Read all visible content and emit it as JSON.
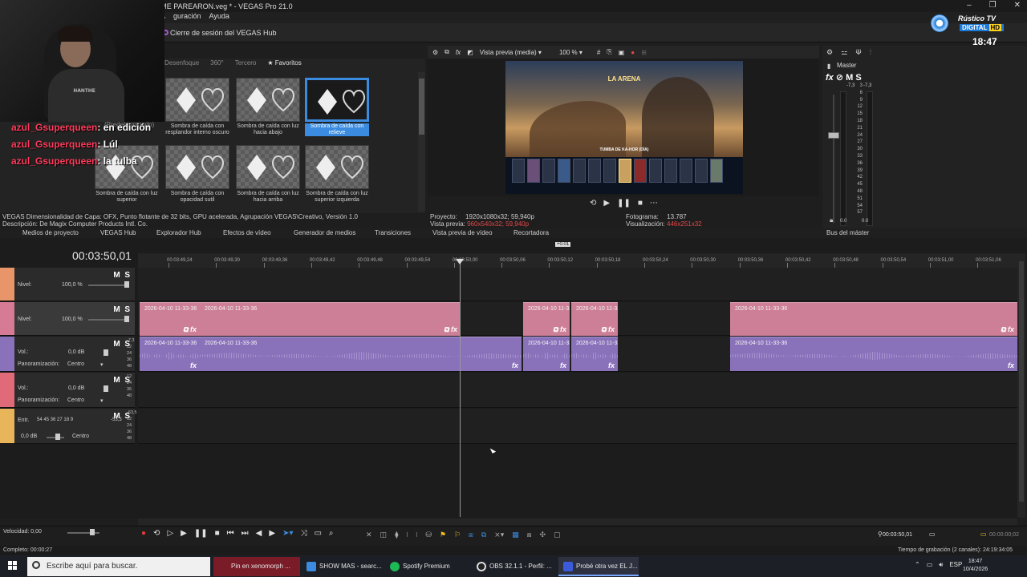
{
  "window": {
    "title": "Probé otra vez EL JUEGO DE INVINCIBLE y ME PAREARON.veg * - VEGAS Pro 21.0",
    "minimize": "–",
    "maximize": "❐",
    "close": "✕"
  },
  "menu": {
    "items": [
      "A",
      "guración",
      "Ayuda"
    ]
  },
  "hub": {
    "label": "Cierre de sesión del VEGAS Hub"
  },
  "tv": {
    "brand": "Rústico TV",
    "sub": "DIGITAL",
    "hd": "HD",
    "clock": "18:47"
  },
  "chat": {
    "watermark": "(Predeterminado)",
    "lines": [
      {
        "user": "azul_Gsuperqueen",
        "msg": ": en edición"
      },
      {
        "user": "azul_Gsuperqueen",
        "msg": ": Lúl"
      },
      {
        "user": "azul_Gsuperqueen",
        "msg": ": la tulba"
      }
    ]
  },
  "fx_browser": {
    "tabs": [
      "Desenfoque",
      "360°",
      "Tercero",
      "Favoritos"
    ],
    "presets": [
      "Sombra de caída con resplandor interno oscuro",
      "Sombra de caída con luz hacia abajo",
      "Sombra de caída con relieve",
      "Sombra de caída con luz superior",
      "Sombra de caída con opacidad sutil",
      "Sombra de caída con luz hacia arriba",
      "Sombra de caída con luz superior izquierda"
    ],
    "info_line1": "VEGAS Dimensionalidad de Capa: OFX, Punto flotante de 32 bits, GPU acelerada, Agrupación VEGAS\\Creativo, Versión 1.0",
    "info_line2": "Descripción: De Magix Computer Products Intl. Co."
  },
  "dock_tabs": [
    "Medios de proyecto",
    "VEGAS Hub",
    "Explorador Hub",
    "Efectos de vídeo",
    "Generador de medios",
    "Transiciones",
    "Vista previa de vídeo",
    "Recortadora",
    "Bus del máster"
  ],
  "preview": {
    "mode": "Vista previa (media)",
    "zoom": "100 %",
    "game_title": "LA ARENA",
    "game_subtitle": "TUMBA DE KA-HOR (DÍA)",
    "proyecto_label": "Proyecto:",
    "proyecto_val": "1920x1080x32; 59,940p",
    "vista_label": "Vista previa:",
    "vista_val": "960x540x32; 59,940p",
    "fotograma_label": "Fotograma:",
    "fotograma_val": "13.787",
    "visual_label": "Visualización:",
    "visual_val": "446x251x32"
  },
  "master": {
    "title": "Master",
    "fx": "fx",
    "m": "M",
    "s": "S",
    "peak_l": "-7,3",
    "peak_r": "-7,3",
    "scale": [
      "3",
      "6",
      "9",
      "12",
      "15",
      "18",
      "21",
      "24",
      "27",
      "30",
      "33",
      "36",
      "39",
      "42",
      "45",
      "48",
      "51",
      "54",
      "57"
    ],
    "bottom_l": "0.0",
    "bottom_r": "0.0"
  },
  "timeline": {
    "timecode": "00:03:50,01",
    "region_label": "+0.01",
    "ticks": [
      "00:03:49,24",
      "00:03:49,30",
      "00:03:49,36",
      "00:03:49,42",
      "00:03:49,48",
      "00:03:49,54",
      "00:03:50,00",
      "00:03:50,06",
      "00:03:50,12",
      "00:03:50,18",
      "00:03:50,24",
      "00:03:50,30",
      "00:03:50,36",
      "00:03:50,42",
      "00:03:50,48",
      "00:03:50,54",
      "00:03:51,00",
      "00:03:51,06"
    ],
    "tracks": [
      {
        "type": "video",
        "level_label": "Nivel:",
        "level": "100,0 %",
        "color": "#e8956a"
      },
      {
        "type": "video",
        "level_label": "Nivel:",
        "level": "100,0 %",
        "color": "#d77a95"
      },
      {
        "type": "audio",
        "vol_label": "Vol.:",
        "vol": "0,0 dB",
        "pan_label": "Panoramización:",
        "pan": "Centro",
        "color": "#8a72bb"
      },
      {
        "type": "audio",
        "vol_label": "Vol.:",
        "vol": "0,0 dB",
        "pan_label": "Panoramización:",
        "pan": "Centro",
        "color": "#e06a78"
      },
      {
        "type": "audio",
        "vol_label": "Entr.",
        "vol": "0,0 dB",
        "pan": "Centro",
        "color": "#e8b55a",
        "in_levels": "54  45  36  27  18  9",
        "in_peak": "-53,3"
      }
    ],
    "clip_label": "2026-04-10 11-33-36",
    "clip_label_short": "2026-04-10 11-33-3",
    "mini_scale_a": [
      "-7,3",
      "12",
      "24",
      "36",
      "48"
    ],
    "mini_scale_b": [
      "12",
      "24",
      "36",
      "48"
    ],
    "mini_scale_c": [
      "-63,5",
      "12",
      "24",
      "36",
      "48"
    ]
  },
  "transport": {
    "speed_label": "Velocidad: 0,00",
    "end_time": "00:03:50,01",
    "end_time2": "00:00:00;02"
  },
  "status": {
    "left": "Completo: 00:00:27",
    "right": "Tiempo de grabación (2 canales): 24:19:34:05"
  },
  "taskbar": {
    "search": "Escribe aquí para buscar.",
    "apps": [
      "Pin en xenomorph ...",
      "SHOW MAS - searc...",
      "Spotify Premium",
      "OBS 32.1.1 - Perfil: ...",
      "Probé otra vez EL J..."
    ],
    "lang": "ESP",
    "time": "18:47",
    "date": "10/4/2026"
  },
  "colors": {
    "accent": "#3b8ce0",
    "video_clip": "#cc7f97",
    "audio_clip": "#8a72bb",
    "record": "#e23b3b"
  }
}
